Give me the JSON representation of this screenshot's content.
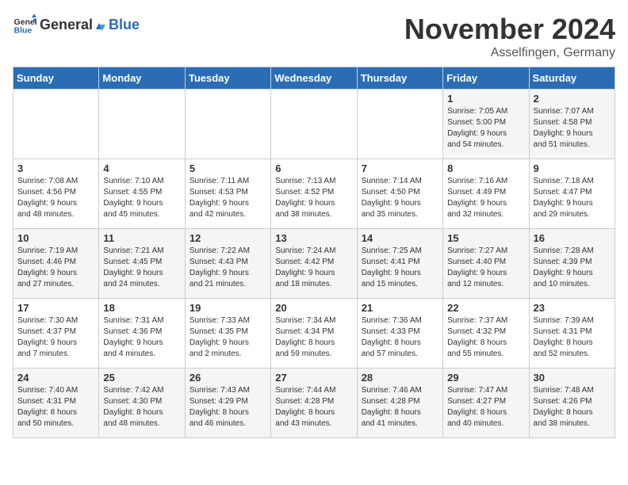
{
  "logo": {
    "general": "General",
    "blue": "Blue"
  },
  "title": "November 2024",
  "location": "Asselfingen, Germany",
  "days_of_week": [
    "Sunday",
    "Monday",
    "Tuesday",
    "Wednesday",
    "Thursday",
    "Friday",
    "Saturday"
  ],
  "weeks": [
    [
      {
        "day": "",
        "info": ""
      },
      {
        "day": "",
        "info": ""
      },
      {
        "day": "",
        "info": ""
      },
      {
        "day": "",
        "info": ""
      },
      {
        "day": "",
        "info": ""
      },
      {
        "day": "1",
        "info": "Sunrise: 7:05 AM\nSunset: 5:00 PM\nDaylight: 9 hours\nand 54 minutes."
      },
      {
        "day": "2",
        "info": "Sunrise: 7:07 AM\nSunset: 4:58 PM\nDaylight: 9 hours\nand 51 minutes."
      }
    ],
    [
      {
        "day": "3",
        "info": "Sunrise: 7:08 AM\nSunset: 4:56 PM\nDaylight: 9 hours\nand 48 minutes."
      },
      {
        "day": "4",
        "info": "Sunrise: 7:10 AM\nSunset: 4:55 PM\nDaylight: 9 hours\nand 45 minutes."
      },
      {
        "day": "5",
        "info": "Sunrise: 7:11 AM\nSunset: 4:53 PM\nDaylight: 9 hours\nand 42 minutes."
      },
      {
        "day": "6",
        "info": "Sunrise: 7:13 AM\nSunset: 4:52 PM\nDaylight: 9 hours\nand 38 minutes."
      },
      {
        "day": "7",
        "info": "Sunrise: 7:14 AM\nSunset: 4:50 PM\nDaylight: 9 hours\nand 35 minutes."
      },
      {
        "day": "8",
        "info": "Sunrise: 7:16 AM\nSunset: 4:49 PM\nDaylight: 9 hours\nand 32 minutes."
      },
      {
        "day": "9",
        "info": "Sunrise: 7:18 AM\nSunset: 4:47 PM\nDaylight: 9 hours\nand 29 minutes."
      }
    ],
    [
      {
        "day": "10",
        "info": "Sunrise: 7:19 AM\nSunset: 4:46 PM\nDaylight: 9 hours\nand 27 minutes."
      },
      {
        "day": "11",
        "info": "Sunrise: 7:21 AM\nSunset: 4:45 PM\nDaylight: 9 hours\nand 24 minutes."
      },
      {
        "day": "12",
        "info": "Sunrise: 7:22 AM\nSunset: 4:43 PM\nDaylight: 9 hours\nand 21 minutes."
      },
      {
        "day": "13",
        "info": "Sunrise: 7:24 AM\nSunset: 4:42 PM\nDaylight: 9 hours\nand 18 minutes."
      },
      {
        "day": "14",
        "info": "Sunrise: 7:25 AM\nSunset: 4:41 PM\nDaylight: 9 hours\nand 15 minutes."
      },
      {
        "day": "15",
        "info": "Sunrise: 7:27 AM\nSunset: 4:40 PM\nDaylight: 9 hours\nand 12 minutes."
      },
      {
        "day": "16",
        "info": "Sunrise: 7:28 AM\nSunset: 4:39 PM\nDaylight: 9 hours\nand 10 minutes."
      }
    ],
    [
      {
        "day": "17",
        "info": "Sunrise: 7:30 AM\nSunset: 4:37 PM\nDaylight: 9 hours\nand 7 minutes."
      },
      {
        "day": "18",
        "info": "Sunrise: 7:31 AM\nSunset: 4:36 PM\nDaylight: 9 hours\nand 4 minutes."
      },
      {
        "day": "19",
        "info": "Sunrise: 7:33 AM\nSunset: 4:35 PM\nDaylight: 9 hours\nand 2 minutes."
      },
      {
        "day": "20",
        "info": "Sunrise: 7:34 AM\nSunset: 4:34 PM\nDaylight: 8 hours\nand 59 minutes."
      },
      {
        "day": "21",
        "info": "Sunrise: 7:36 AM\nSunset: 4:33 PM\nDaylight: 8 hours\nand 57 minutes."
      },
      {
        "day": "22",
        "info": "Sunrise: 7:37 AM\nSunset: 4:32 PM\nDaylight: 8 hours\nand 55 minutes."
      },
      {
        "day": "23",
        "info": "Sunrise: 7:39 AM\nSunset: 4:31 PM\nDaylight: 8 hours\nand 52 minutes."
      }
    ],
    [
      {
        "day": "24",
        "info": "Sunrise: 7:40 AM\nSunset: 4:31 PM\nDaylight: 8 hours\nand 50 minutes."
      },
      {
        "day": "25",
        "info": "Sunrise: 7:42 AM\nSunset: 4:30 PM\nDaylight: 8 hours\nand 48 minutes."
      },
      {
        "day": "26",
        "info": "Sunrise: 7:43 AM\nSunset: 4:29 PM\nDaylight: 8 hours\nand 46 minutes."
      },
      {
        "day": "27",
        "info": "Sunrise: 7:44 AM\nSunset: 4:28 PM\nDaylight: 8 hours\nand 43 minutes."
      },
      {
        "day": "28",
        "info": "Sunrise: 7:46 AM\nSunset: 4:28 PM\nDaylight: 8 hours\nand 41 minutes."
      },
      {
        "day": "29",
        "info": "Sunrise: 7:47 AM\nSunset: 4:27 PM\nDaylight: 8 hours\nand 40 minutes."
      },
      {
        "day": "30",
        "info": "Sunrise: 7:48 AM\nSunset: 4:26 PM\nDaylight: 8 hours\nand 38 minutes."
      }
    ]
  ]
}
